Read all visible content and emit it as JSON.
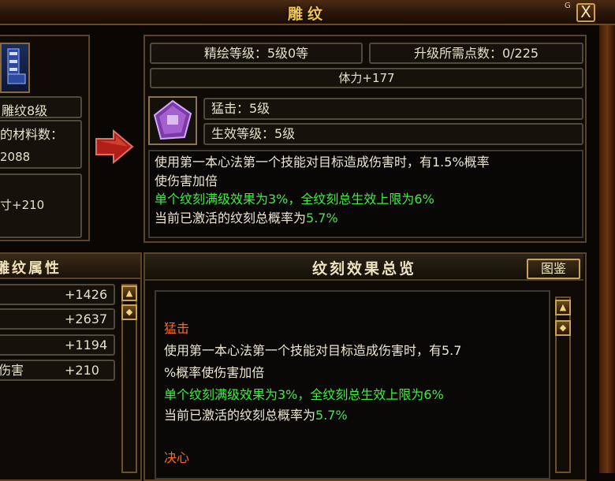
{
  "window": {
    "title": "雕纹",
    "close_label": "X",
    "help_glyph": "G"
  },
  "left_top": {
    "carving_level": "雕纹8级",
    "materials_label": "的材料数：",
    "materials_value": "2088",
    "bonus": "寸+210"
  },
  "right_top": {
    "refine_level": "精绘等级：5级0等",
    "upgrade_points": "升级所需点数：0/225",
    "stat": "体力+177",
    "skill_name": "猛击：5级",
    "effect_level": "生效等级：5级",
    "desc_line1": "使用第一本心法第一个技能对目标造成伤害时，有1.5%概率",
    "desc_line2": "使伤害加倍",
    "desc_line3": "单个纹刻满级效果为3%，全纹刻总生效上限为6%",
    "desc_line4_prefix": "当前已激活的纹刻总概率为",
    "desc_line4_value": "5.7%"
  },
  "left_bottom": {
    "title": "雕纹属性",
    "rows": [
      {
        "label": "",
        "value": "+1426"
      },
      {
        "label": "",
        "value": "+2637"
      },
      {
        "label": "",
        "value": "+1194"
      },
      {
        "label": "伤害",
        "value": "+210"
      }
    ]
  },
  "right_bottom": {
    "title": "纹刻效果总览",
    "catalog_button": "图鉴",
    "effects": [
      {
        "name": "猛击",
        "line1": "使用第一本心法第一个技能对目标造成伤害时，有5.7",
        "line2": "%概率使伤害加倍",
        "line3": "单个纹刻满级效果为3%，全纹刻总生效上限为6%",
        "line4_prefix": "当前已激活的纹刻总概率为",
        "line4_value": "5.7%"
      },
      {
        "name": "决心"
      }
    ]
  },
  "colors": {
    "title_gold": "#f0c453",
    "green_text": "#3df03d",
    "orange_heading": "#ff6a1c"
  },
  "icons": [
    "close-icon",
    "boots-icon",
    "arrow-right-icon",
    "carving-gem-icon",
    "scroll-up-icon",
    "scroll-top-icon"
  ]
}
